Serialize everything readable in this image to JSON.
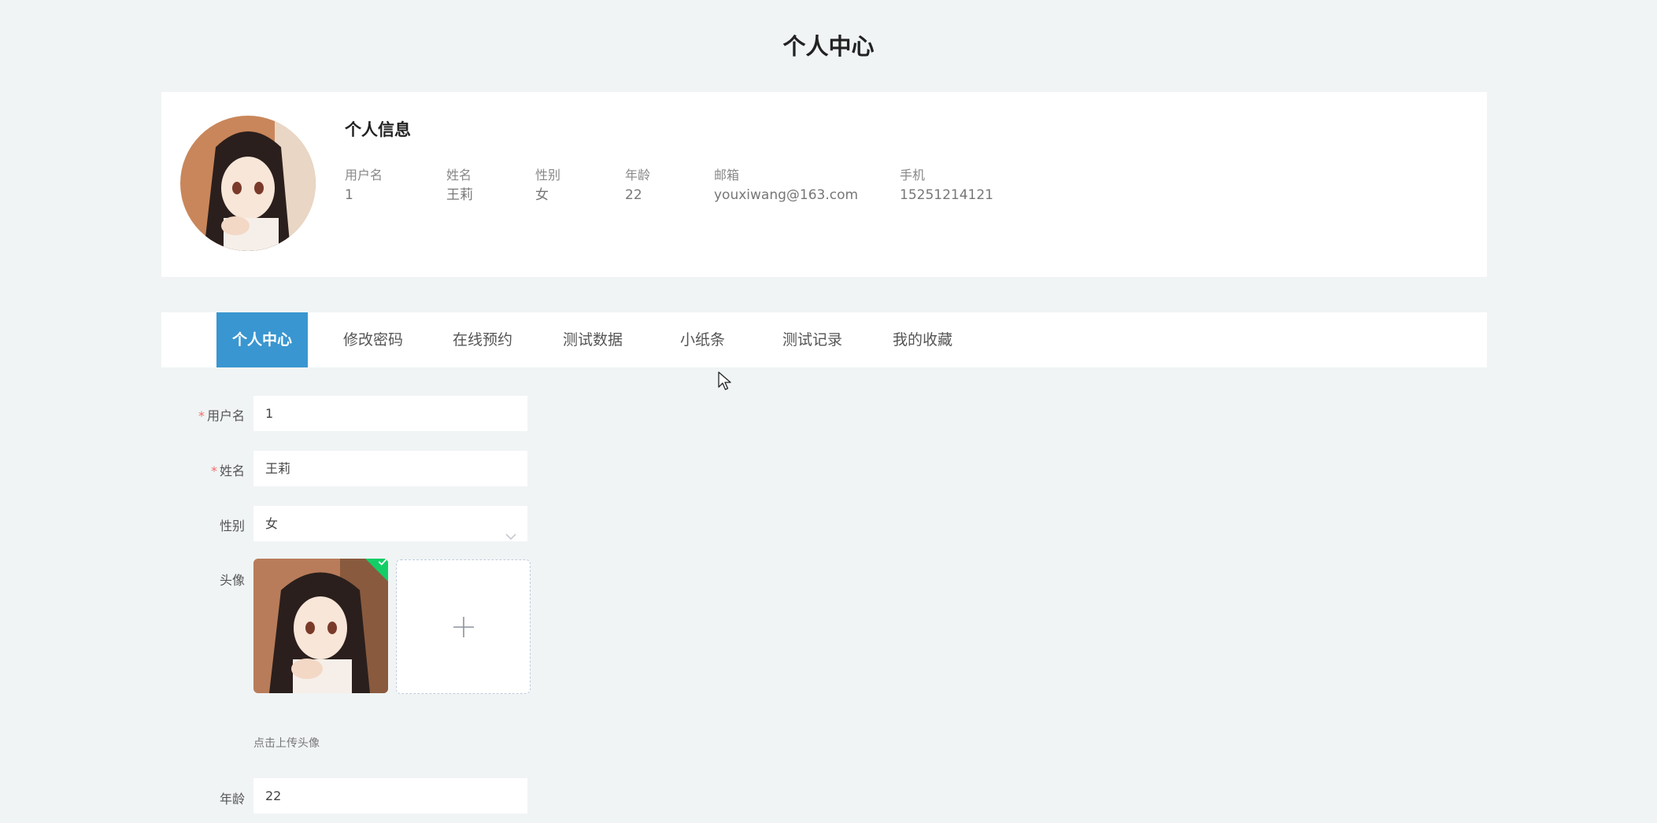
{
  "page": {
    "title": "个人中心"
  },
  "profile": {
    "section_title": "个人信息",
    "fields": [
      {
        "label": "用户名",
        "value": "1"
      },
      {
        "label": "姓名",
        "value": "王莉"
      },
      {
        "label": "性别",
        "value": "女"
      },
      {
        "label": "年龄",
        "value": "22"
      },
      {
        "label": "邮箱",
        "value": "youxiwang@163.com"
      },
      {
        "label": "手机",
        "value": "15251214121"
      }
    ]
  },
  "tabs": [
    {
      "label": "个人中心",
      "active": true
    },
    {
      "label": "修改密码",
      "active": false
    },
    {
      "label": "在线预约",
      "active": false
    },
    {
      "label": "测试数据",
      "active": false
    },
    {
      "label": "小纸条",
      "active": false
    },
    {
      "label": "测试记录",
      "active": false
    },
    {
      "label": "我的收藏",
      "active": false
    }
  ],
  "form": {
    "username": {
      "label": "用户名",
      "value": "1",
      "required": true
    },
    "name": {
      "label": "姓名",
      "value": "王莉",
      "required": true
    },
    "gender": {
      "label": "性别",
      "value": "女"
    },
    "avatar": {
      "label": "头像",
      "hint": "点击上传头像"
    },
    "age": {
      "label": "年龄",
      "value": "22"
    }
  },
  "colors": {
    "accent": "#3a96d0",
    "background": "#f0f4f5",
    "required": "#f56c6c",
    "success": "#13ce66"
  }
}
